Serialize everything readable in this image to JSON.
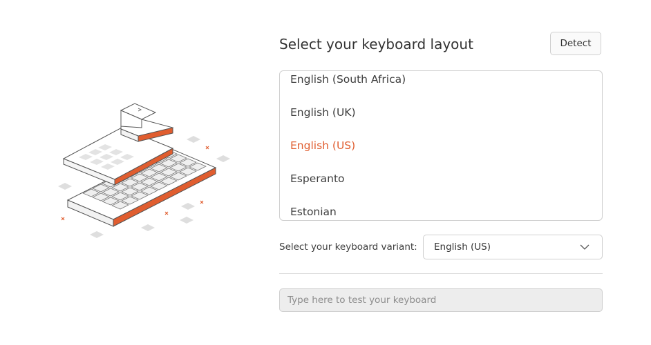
{
  "header": {
    "title": "Select your keyboard layout",
    "detect_label": "Detect"
  },
  "layouts": {
    "items": [
      {
        "label": "English (South Africa)",
        "selected": false
      },
      {
        "label": "English (UK)",
        "selected": false
      },
      {
        "label": "English (US)",
        "selected": true
      },
      {
        "label": "Esperanto",
        "selected": false
      },
      {
        "label": "Estonian",
        "selected": false
      }
    ]
  },
  "variant": {
    "label": "Select your keyboard variant:",
    "value": "English (US)",
    "icon": "chevron-down-icon"
  },
  "test": {
    "placeholder": "Type here to test your keyboard",
    "value": ""
  },
  "illustration": {
    "icon": "keyboard-illustration",
    "accent_color": "#e05d2f"
  },
  "colors": {
    "accent": "#e05d2f",
    "text": "#3d3d3d",
    "border": "#cfcfcf"
  }
}
